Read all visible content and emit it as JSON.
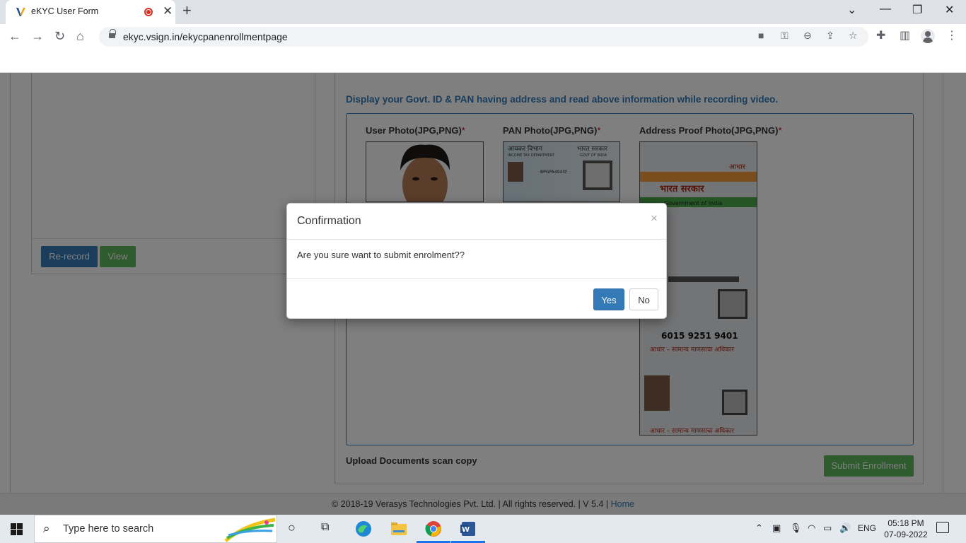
{
  "browser": {
    "tab_title": "eKYC User Form",
    "url": "ekyc.vsign.in/ekycpanenrollmentpage"
  },
  "page": {
    "left_panel": {
      "rerecord_label": "Re-record",
      "view_label": "View"
    },
    "instruction": "Display your Govt. ID & PAN having address and read above information while recording video.",
    "photos": [
      {
        "label": "User Photo(JPG,PNG)",
        "required": "*"
      },
      {
        "label": "PAN Photo(JPG,PNG)",
        "required": "*"
      },
      {
        "label": "Address Proof Photo(JPG,PNG)",
        "required": "*"
      }
    ],
    "upload_label": "Upload Documents scan copy",
    "submit_label": "Submit Enrollment",
    "footer": {
      "text": "©  2018-19  Verasys Technologies Pvt. Ltd. | All rights reserved. | V 5.4 | ",
      "home": "Home"
    }
  },
  "modal": {
    "title": "Confirmation",
    "close": "×",
    "message": "Are you sure want to submit enrolment??",
    "yes_label": "Yes",
    "no_label": "No"
  },
  "taskbar": {
    "search_placeholder": "Type here to search",
    "language": "ENG",
    "time": "05:18 PM",
    "date": "07-09-2022"
  },
  "id_cards": {
    "pan": {
      "dept": "आयकर विभाग",
      "dept_en": "INCOME TAX DEPARTMENT",
      "govt": "भारत सरकार",
      "govt_en": "GOVT OF INDIA",
      "pan_no": "BPGPA4943F"
    },
    "aadhaar": {
      "govt_hi": "भारत सरकार",
      "govt_en": "Government of India",
      "aadhaar_label": "आधार",
      "number": "6015 9251 9401",
      "tagline": "आधार – सामान्य माणसाचा अधिकार"
    }
  }
}
